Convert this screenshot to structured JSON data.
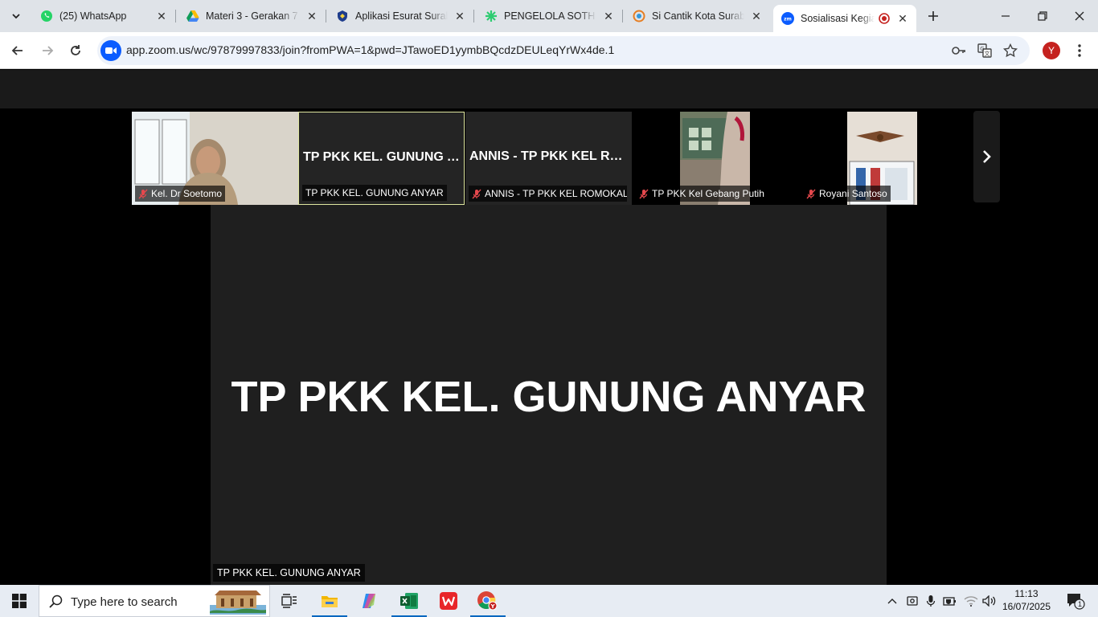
{
  "browser": {
    "tabs": [
      {
        "title": "(25) WhatsApp",
        "icon": "whatsapp-icon",
        "active": false
      },
      {
        "title": "Materi 3 - Gerakan 7",
        "icon": "google-drive-icon",
        "active": false
      },
      {
        "title": "Aplikasi Esurat Surabaya",
        "icon": "surabaya-crest-icon",
        "active": false
      },
      {
        "title": "PENGELOLA SOTH SURABAYA",
        "icon": "green-star-icon",
        "active": false
      },
      {
        "title": "Si Cantik Kota Surabaya",
        "icon": "si-cantik-icon",
        "active": false
      },
      {
        "title": "Sosialisasi Kegiatan",
        "icon": "zoom-icon",
        "active": true,
        "recording": true
      }
    ],
    "url": "app.zoom.us/wc/97879997833/join?fromPWA=1&pwd=JTawoED1yymbBQcdzDEULeqYrWx4de.1",
    "profile_initial": "Y"
  },
  "zoom": {
    "participants": [
      {
        "tile_name": "",
        "caption": "Kel. Dr Soetomo",
        "muted": true,
        "video": true
      },
      {
        "tile_name": "TP PKK KEL. GUNUNG A...",
        "caption": "TP PKK KEL. GUNUNG ANYAR",
        "muted": false,
        "video": false,
        "active_speaker": true
      },
      {
        "tile_name": "ANNIS - TP PKK KEL RO...",
        "caption": "ANNIS - TP PKK KEL ROMOKALI...",
        "muted": true,
        "video": false
      },
      {
        "tile_name": "",
        "caption": "TP PKK Kel Gebang Putih",
        "muted": true,
        "video": true
      },
      {
        "tile_name": "",
        "caption": "Royani Santoso",
        "muted": true,
        "video": true
      }
    ],
    "main_speaker": {
      "name": "TP PKK KEL. GUNUNG ANYAR",
      "caption": "TP PKK KEL. GUNUNG ANYAR"
    }
  },
  "taskbar": {
    "search_placeholder": "Type here to search",
    "time": "11:13",
    "date": "16/07/2025",
    "notification_count": "1"
  },
  "colors": {
    "accent": "#0067c0",
    "zoom_blue": "#0b5cff",
    "active_border": "#dfe6a0",
    "muted_red": "#e5484d"
  }
}
